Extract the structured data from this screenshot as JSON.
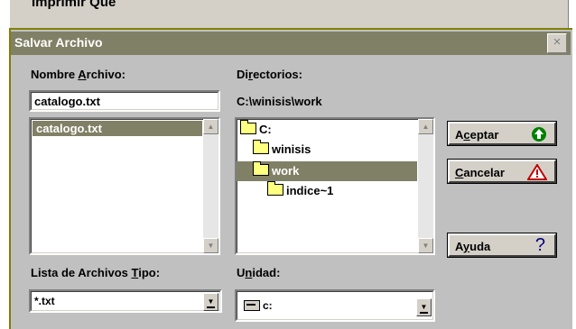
{
  "background_window": {
    "title": "Imprimir Que"
  },
  "dialog": {
    "title": "Salvar Archivo",
    "close_symbol": "×"
  },
  "file_name": {
    "label_before": "Nombre ",
    "label_mnemonic": "A",
    "label_after": "rchivo:",
    "value": "catalogo.txt",
    "list_items": [
      "catalogo.txt"
    ]
  },
  "directories": {
    "label_before": "Di",
    "label_mnemonic": "r",
    "label_after": "ectorios:",
    "current_path": "C:\\winisis\\work",
    "tree": [
      {
        "label": "C:",
        "icon": "open-folder-icon",
        "selected": false
      },
      {
        "label": "winisis",
        "icon": "open-folder-icon",
        "selected": false
      },
      {
        "label": "work",
        "icon": "open-folder-icon",
        "selected": true
      },
      {
        "label": "indice~1",
        "icon": "closed-folder-icon",
        "selected": false
      }
    ]
  },
  "buttons": {
    "accept": {
      "label_before": "A",
      "label_mnemonic": "c",
      "label_after": "eptar",
      "icon": "green-up-arrow-icon"
    },
    "cancel": {
      "label_before": "",
      "label_mnemonic": "C",
      "label_after": "ancelar",
      "icon": "warning-triangle-icon"
    },
    "help": {
      "label_before": "A",
      "label_mnemonic": "y",
      "label_after": "uda",
      "icon": "question-mark-icon"
    }
  },
  "file_type": {
    "label_before": "Lista de Archivos ",
    "label_mnemonic": "T",
    "label_after": "ipo:",
    "selected": "*.txt"
  },
  "drive": {
    "label_before": "U",
    "label_mnemonic": "n",
    "label_after": "idad:",
    "selected": "c:",
    "icon": "drive-icon"
  },
  "colors": {
    "titlebar": "#808066",
    "selection": "#808066",
    "dialog_bg": "#c0c0c0",
    "accept_icon": "#008000",
    "cancel_icon": "#c00000",
    "help_icon": "#000080"
  }
}
